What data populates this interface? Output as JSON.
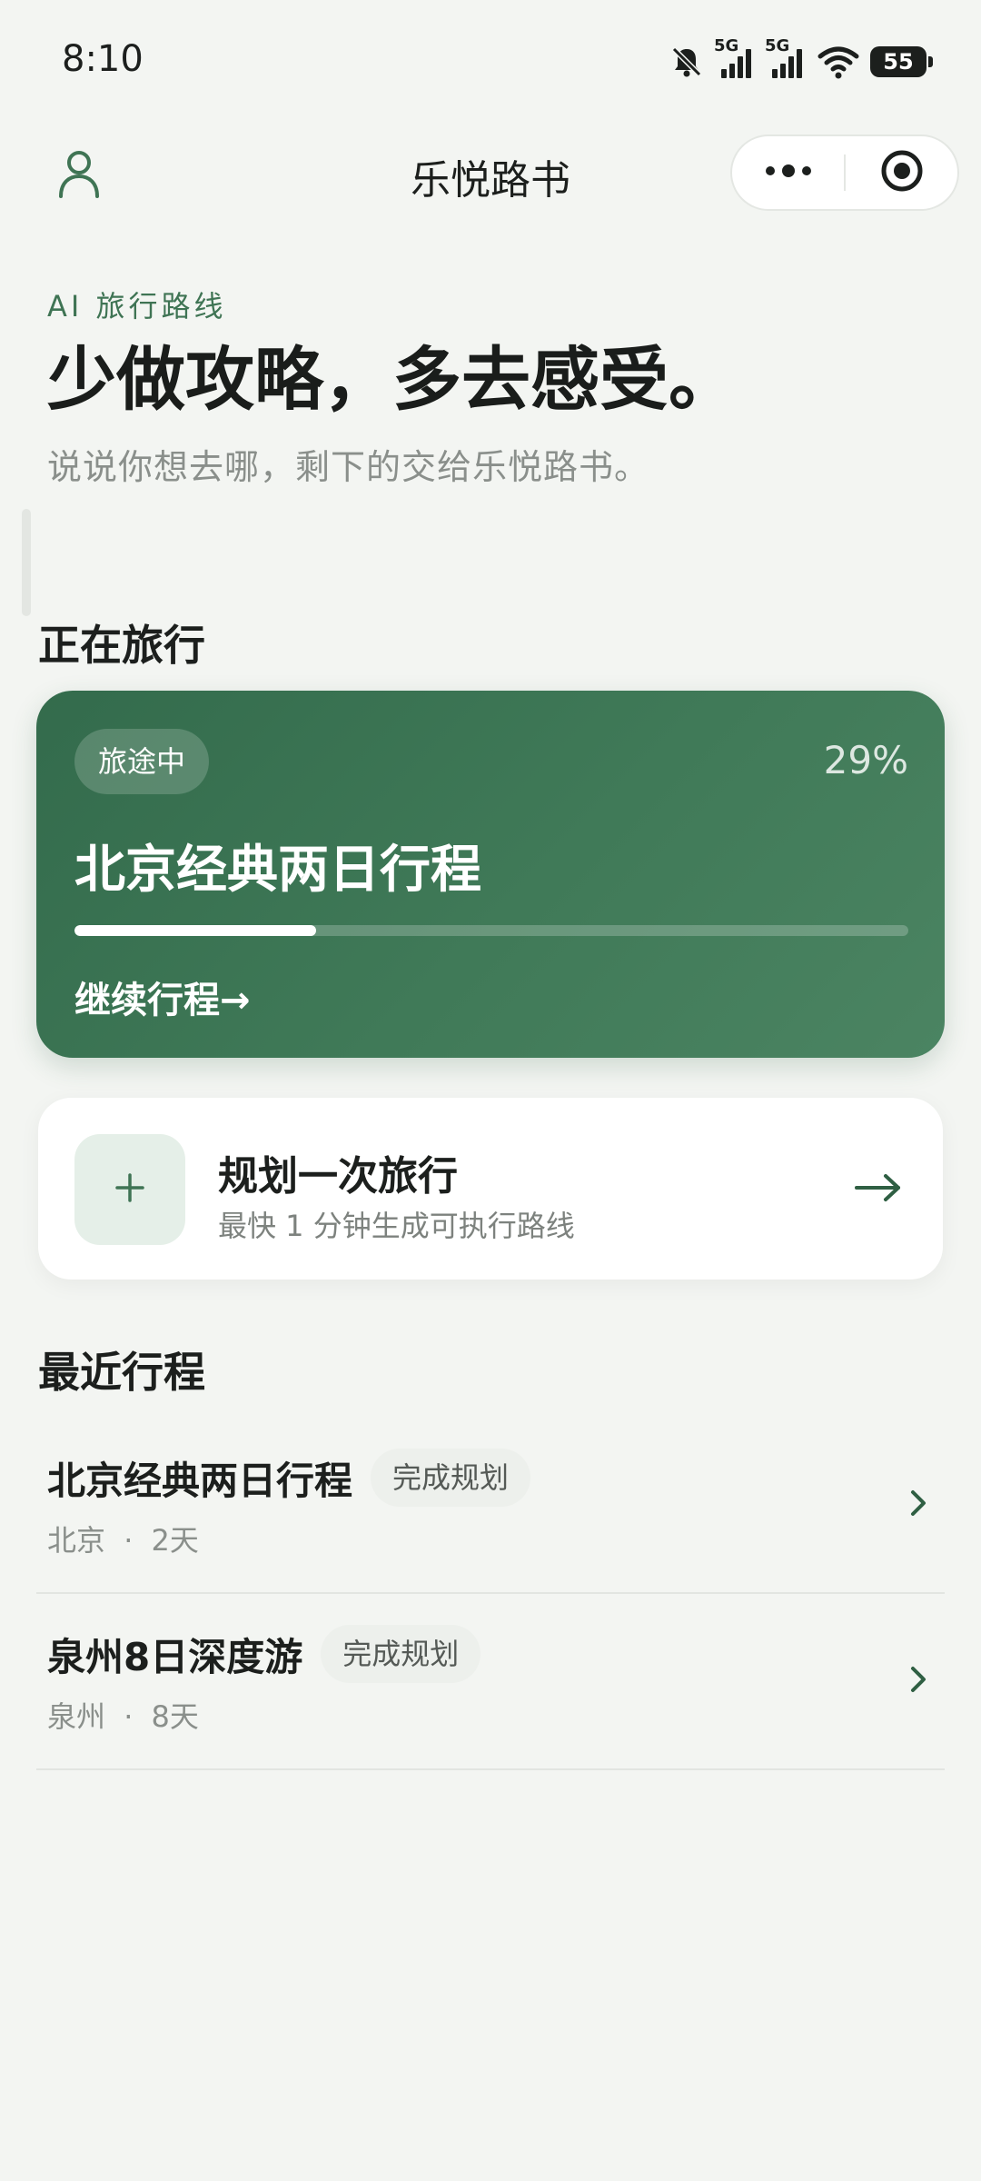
{
  "status_bar": {
    "time": "8:10",
    "network_1": "5G",
    "network_2": "5G",
    "battery": "55",
    "icons": [
      "mute-bell-icon",
      "signal-icon",
      "signal-icon",
      "wifi-icon",
      "battery-icon"
    ]
  },
  "nav": {
    "title": "乐悦路书",
    "icons": [
      "person-icon",
      "more-dots-icon",
      "target-icon"
    ]
  },
  "hero": {
    "eyebrow": "AI 旅行路线",
    "title": "少做攻略，多去感受。",
    "subtitle": "说说你想去哪，剩下的交给乐悦路书。"
  },
  "active_section": {
    "title": "正在旅行"
  },
  "active_trip": {
    "badge": "旅途中",
    "percent_label": "29%",
    "progress": 0.29,
    "name": "北京经典两日行程",
    "continue_label": "继续行程→"
  },
  "plan_card": {
    "icon": "plus-icon",
    "title": "规划一次旅行",
    "subtitle": "最快 1 分钟生成可执行路线",
    "arrow_icon": "arrow-right-icon"
  },
  "recent_section": {
    "title": "最近行程"
  },
  "recent_trips": [
    {
      "name": "北京经典两日行程",
      "badge": "完成规划",
      "city": "北京",
      "separator": "·",
      "duration": "2天"
    },
    {
      "name": "泉州8日深度游",
      "badge": "完成规划",
      "city": "泉州",
      "separator": "·",
      "duration": "8天"
    }
  ],
  "colors": {
    "background": "#f3f5f2",
    "accent": "#3f7454",
    "card_green": "#3a7251",
    "text_primary": "#1c1f1d",
    "text_secondary": "#8a8f8b"
  }
}
